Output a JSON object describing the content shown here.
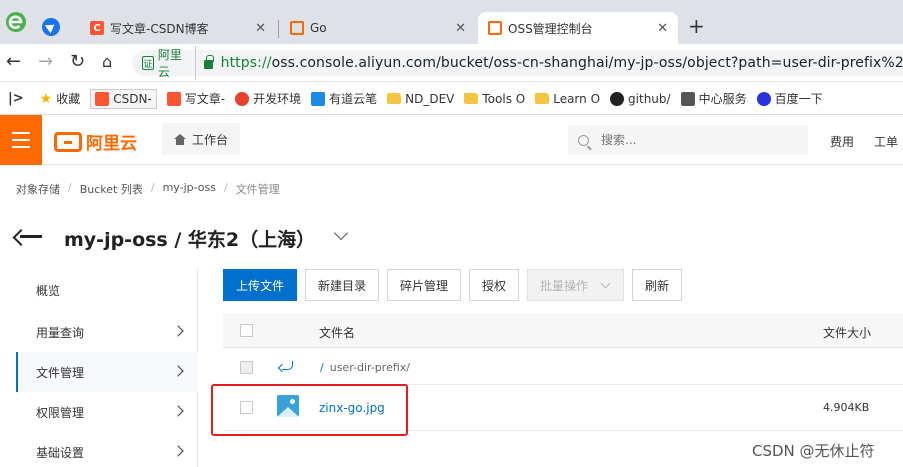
{
  "browser": {
    "tabs": [
      {
        "label": "写文章-CSDN博客",
        "active": false
      },
      {
        "label": "Go",
        "active": false
      },
      {
        "label": "OSS管理控制台",
        "active": true
      }
    ],
    "new_tab_label": "+",
    "address": {
      "site_name": "阿里云",
      "scheme": "https://",
      "rest": "oss.console.aliyun.com/bucket/oss-cn-shanghai/my-jp-oss/object?path=user-dir-prefix%2F"
    },
    "bookmarks": [
      {
        "label": "收藏",
        "icon": "star-icon"
      },
      {
        "label": "CSDN-",
        "icon": "csdn-icon"
      },
      {
        "label": "写文章-",
        "icon": "csdn-icon"
      },
      {
        "label": "开发环境",
        "icon": "dev-icon"
      },
      {
        "label": "有道云笔",
        "icon": "youdao-icon"
      },
      {
        "label": "ND_DEV",
        "icon": "folder-icon"
      },
      {
        "label": "Tools O",
        "icon": "folder-icon"
      },
      {
        "label": "Learn O",
        "icon": "folder-icon"
      },
      {
        "label": "github/",
        "icon": "github-icon"
      },
      {
        "label": "中心服务",
        "icon": "center-icon"
      },
      {
        "label": "百度一下",
        "icon": "baidu-icon"
      }
    ]
  },
  "console": {
    "brand": "阿里云",
    "workbench_label": "工作台",
    "search_placeholder": "搜索...",
    "links": [
      "费用",
      "工单"
    ],
    "accent_color": "#ff6a00",
    "link_color": "#0070cc"
  },
  "breadcrumb": [
    "对象存储",
    "Bucket 列表",
    "my-jp-oss",
    "文件管理"
  ],
  "page_title": "my-jp-oss / 华东2（上海）",
  "left_menu": [
    {
      "label": "概览",
      "has_arrow": false,
      "active": false
    },
    {
      "label": "用量查询",
      "has_arrow": true,
      "active": false
    },
    {
      "label": "文件管理",
      "has_arrow": true,
      "active": true
    },
    {
      "label": "权限管理",
      "has_arrow": true,
      "active": false
    },
    {
      "label": "基础设置",
      "has_arrow": true,
      "active": false
    }
  ],
  "toolbar": {
    "upload": "上传文件",
    "new_dir": "新建目录",
    "fragments": "碎片管理",
    "authorize": "授权",
    "batch": "批量操作",
    "refresh": "刷新"
  },
  "table": {
    "columns": {
      "name": "文件名",
      "size": "文件大小"
    },
    "parent_row": {
      "slash": "/",
      "path": "user-dir-prefix/"
    },
    "files": [
      {
        "name": "zinx-go.jpg",
        "size": "4.904KB"
      }
    ]
  },
  "watermark": "CSDN @无休止符"
}
